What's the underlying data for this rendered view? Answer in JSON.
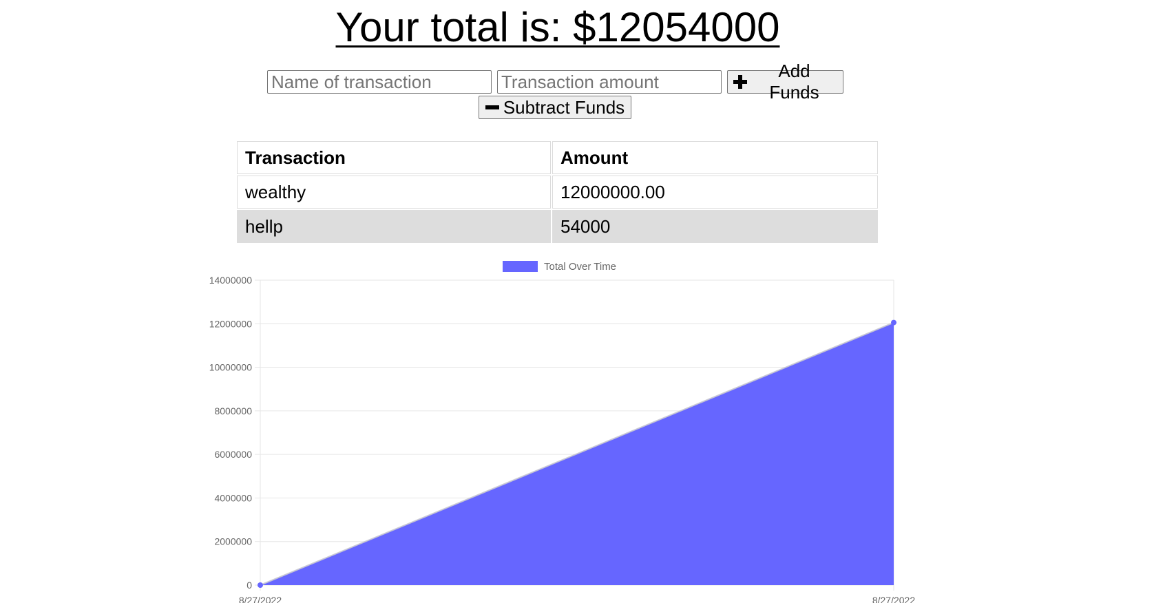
{
  "header": {
    "total_text": "Your total is: $12054000"
  },
  "form": {
    "name_placeholder": "Name of transaction",
    "amount_placeholder": "Transaction amount",
    "add_label": "Add Funds",
    "subtract_label": "Subtract Funds",
    "add_icon": "plus-icon",
    "subtract_icon": "minus-icon"
  },
  "table": {
    "headers": [
      "Transaction",
      "Amount"
    ],
    "rows": [
      {
        "name": "wealthy",
        "amount": "12000000.00"
      },
      {
        "name": "hellp",
        "amount": "54000"
      }
    ],
    "shaded_row_color": "#dddddd"
  },
  "chart_data": {
    "type": "area",
    "title": "",
    "legend": [
      {
        "label": "Total Over Time",
        "color": "#6666ff"
      }
    ],
    "legend_position": "top",
    "x": [
      "8/27/2022",
      "8/27/2022"
    ],
    "series": [
      {
        "name": "Total Over Time",
        "values": [
          0,
          12054000
        ],
        "color": "#6666ff"
      }
    ],
    "yticks": [
      "0",
      "2000000",
      "4000000",
      "6000000",
      "8000000",
      "10000000",
      "12000000",
      "14000000"
    ],
    "ylim": [
      0,
      14000000
    ],
    "xlabel": "",
    "ylabel": "",
    "grid": true
  }
}
